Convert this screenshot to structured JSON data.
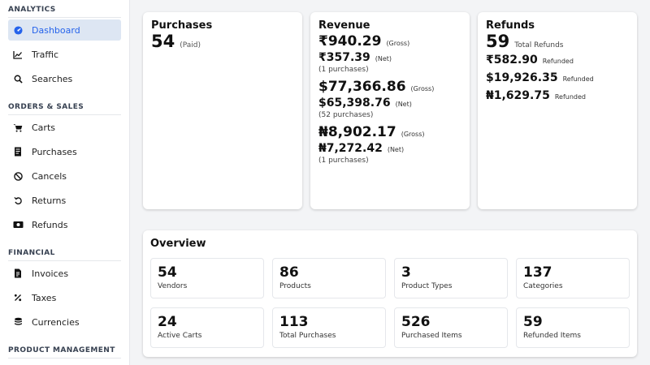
{
  "sidebar": {
    "sections": [
      {
        "title": "ANALYTICS",
        "items": [
          {
            "label": "Dashboard",
            "icon": "dashboard-icon",
            "active": true
          },
          {
            "label": "Traffic",
            "icon": "line-chart-icon"
          },
          {
            "label": "Searches",
            "icon": "search-icon"
          }
        ]
      },
      {
        "title": "ORDERS & SALES",
        "items": [
          {
            "label": "Carts",
            "icon": "cart-icon"
          },
          {
            "label": "Purchases",
            "icon": "receipt-icon"
          },
          {
            "label": "Cancels",
            "icon": "cancel-icon"
          },
          {
            "label": "Returns",
            "icon": "return-icon"
          },
          {
            "label": "Refunds",
            "icon": "refund-icon"
          }
        ]
      },
      {
        "title": "FINANCIAL",
        "items": [
          {
            "label": "Invoices",
            "icon": "invoice-icon"
          },
          {
            "label": "Taxes",
            "icon": "percent-icon"
          },
          {
            "label": "Currencies",
            "icon": "coins-icon"
          }
        ]
      },
      {
        "title": "PRODUCT MANAGEMENT",
        "items": []
      }
    ]
  },
  "purchases": {
    "title": "Purchases",
    "count": "54",
    "status": "(Paid)"
  },
  "revenue": {
    "title": "Revenue",
    "groups": [
      {
        "gross": "₹940.29",
        "gross_label": "(Gross)",
        "net": "₹357.39",
        "net_label": "(Net)",
        "count": "(1 purchases)"
      },
      {
        "gross": "$77,366.86",
        "gross_label": "(Gross)",
        "net": "$65,398.76",
        "net_label": "(Net)",
        "count": "(52 purchases)"
      },
      {
        "gross": "₦8,902.17",
        "gross_label": "(Gross)",
        "net": "₦7,272.42",
        "net_label": "(Net)",
        "count": "(1 purchases)"
      }
    ]
  },
  "refunds": {
    "title": "Refunds",
    "count": "59",
    "count_label": "Total Refunds",
    "amounts": [
      {
        "value": "₹582.90",
        "label": "Refunded"
      },
      {
        "value": "$19,926.35",
        "label": "Refunded"
      },
      {
        "value": "₦1,629.75",
        "label": "Refunded"
      }
    ]
  },
  "overview": {
    "title": "Overview",
    "tiles": [
      {
        "value": "54",
        "label": "Vendors"
      },
      {
        "value": "86",
        "label": "Products"
      },
      {
        "value": "3",
        "label": "Product Types"
      },
      {
        "value": "137",
        "label": "Categories"
      },
      {
        "value": "24",
        "label": "Active Carts"
      },
      {
        "value": "113",
        "label": "Total Purchases"
      },
      {
        "value": "526",
        "label": "Purchased Items"
      },
      {
        "value": "59",
        "label": "Refunded Items"
      }
    ]
  }
}
